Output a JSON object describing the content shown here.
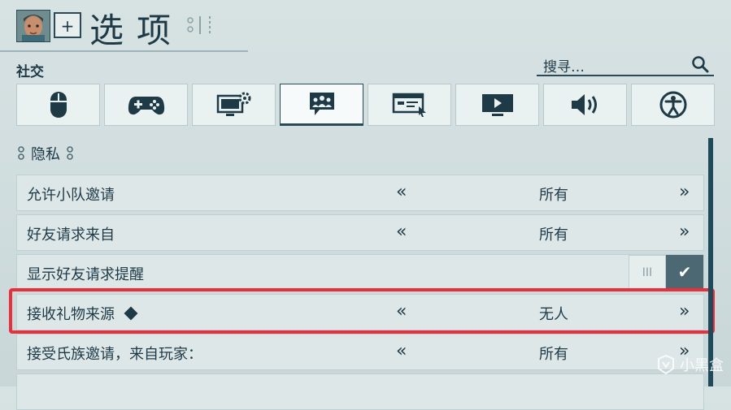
{
  "header": {
    "title": "选项",
    "plus_label": "+"
  },
  "section": {
    "label": "社交"
  },
  "search": {
    "placeholder": "搜寻…"
  },
  "tabs": [
    {
      "name": "mouse-icon"
    },
    {
      "name": "gamepad-icon"
    },
    {
      "name": "display-settings-icon"
    },
    {
      "name": "social-group-icon",
      "active": true
    },
    {
      "name": "interface-icon"
    },
    {
      "name": "monitor-icon"
    },
    {
      "name": "speaker-icon"
    },
    {
      "name": "accessibility-icon"
    }
  ],
  "privacy": {
    "label": "隐私"
  },
  "rows": [
    {
      "label": "允许小队邀请",
      "value": "所有"
    },
    {
      "label": "好友请求来自",
      "value": "所有"
    },
    {
      "label": "显示好友请求提醒",
      "toggle_on": true
    },
    {
      "label": "接收礼物来源",
      "value": "无人"
    },
    {
      "label": "接受氏族邀请，来自玩家：",
      "value": "所有"
    }
  ],
  "arrows": {
    "left": "«",
    "right": "»"
  },
  "toggle": {
    "off": "III",
    "on": "✔"
  },
  "watermark": {
    "text": "小黑盒"
  },
  "colors": {
    "accent": "#1f3a47",
    "highlight": "#e8303c",
    "toggle_on": "#4b6873"
  }
}
